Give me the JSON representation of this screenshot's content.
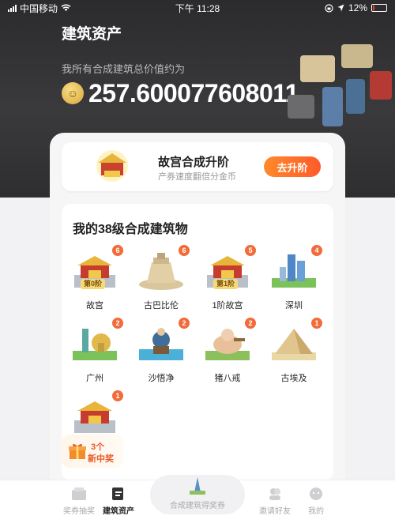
{
  "status_bar": {
    "carrier": "中国移动",
    "time": "下午 11:28",
    "battery": "12%"
  },
  "header": {
    "title": "建筑资产",
    "total_label": "我所有合成建筑总价值约为",
    "total_value": "257.600077608011",
    "coin_glyph": "☺"
  },
  "upgrade_card": {
    "title": "故宫合成升阶",
    "subtitle": "产券速度翻倍分金币",
    "button_label": "去升阶"
  },
  "buildings": {
    "section_title": "我的38级合成建筑物",
    "items": [
      {
        "name": "故宫",
        "count": "6",
        "tier": "第0阶",
        "kind": "palace"
      },
      {
        "name": "古巴比伦",
        "count": "6",
        "tier": "",
        "kind": "babel"
      },
      {
        "name": "1阶故宫",
        "count": "5",
        "tier": "第1阶",
        "kind": "palace"
      },
      {
        "name": "深圳",
        "count": "4",
        "tier": "",
        "kind": "city"
      },
      {
        "name": "广州",
        "count": "2",
        "tier": "",
        "kind": "tower"
      },
      {
        "name": "沙悟净",
        "count": "2",
        "tier": "",
        "kind": "monk"
      },
      {
        "name": "猪八戒",
        "count": "2",
        "tier": "",
        "kind": "pig"
      },
      {
        "name": "古埃及",
        "count": "1",
        "tier": "",
        "kind": "pyramid"
      },
      {
        "name": "",
        "count": "1",
        "tier": "",
        "kind": "palace"
      }
    ]
  },
  "new_prize": {
    "count": "3个",
    "label": "新中奖"
  },
  "tabbar": {
    "tabs": [
      {
        "label": "奖券抽奖",
        "active": false
      },
      {
        "label": "建筑资产",
        "active": true
      },
      {
        "label": "合成建筑得奖券",
        "active": false
      },
      {
        "label": "邀请好友",
        "active": false
      },
      {
        "label": "我的",
        "active": false
      }
    ]
  },
  "colors": {
    "accent": "#ff5a2a",
    "badge": "#f26b3a",
    "header_bg": "#2b2b2d"
  }
}
